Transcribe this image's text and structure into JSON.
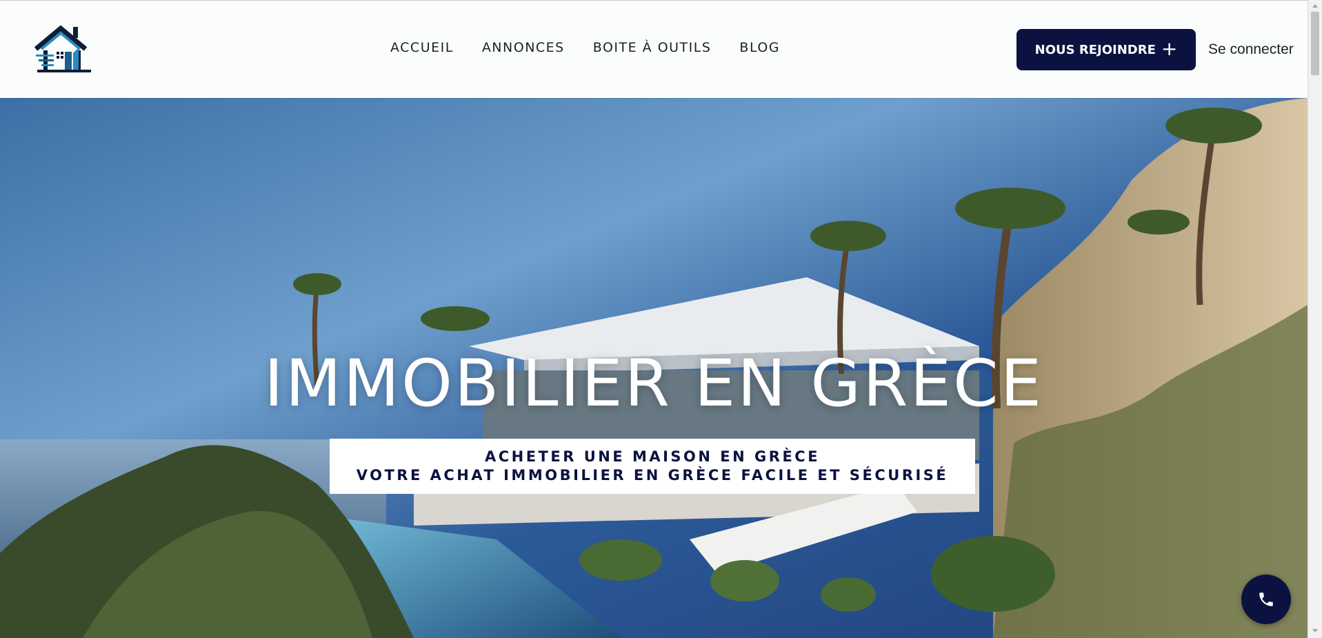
{
  "header": {
    "logo_icon": "house-logo-icon",
    "nav": [
      {
        "label": "ACCUEIL"
      },
      {
        "label": "ANNONCES"
      },
      {
        "label": "BOITE À OUTILS"
      },
      {
        "label": "BLOG"
      }
    ],
    "join_label": "NOUS REJOINDRE",
    "join_icon": "plus-icon",
    "login_label": "Se connecter"
  },
  "hero": {
    "title": "IMMOBILIER EN GRÈCE",
    "subtitle_line1": "ACHETER UNE MAISON EN GRÈCE",
    "subtitle_line2": "VOTRE ACHAT IMMOBILIER EN GRÈCE FACILE ET SÉCURISÉ",
    "background_image": "modern white villa with pool, palm trees, rocky hillside and sea"
  },
  "floating": {
    "call_icon": "phone-icon"
  },
  "colors": {
    "navy": "#0b1240",
    "header_bg": "#fbfdfd",
    "text_dark": "#1b1f2a",
    "white": "#ffffff"
  }
}
